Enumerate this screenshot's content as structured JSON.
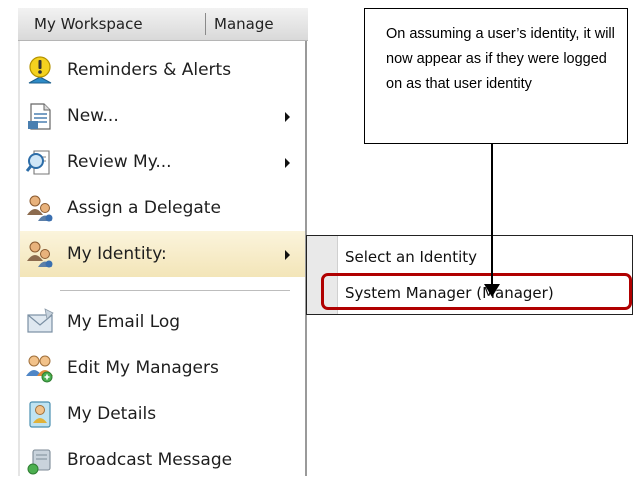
{
  "menubar": {
    "items": [
      "My Workspace",
      "Manage"
    ]
  },
  "menu": {
    "items": [
      {
        "label": "Reminders & Alerts",
        "icon": "alert-icon",
        "has_submenu": false
      },
      {
        "label": "New...",
        "icon": "new-document-icon",
        "has_submenu": true
      },
      {
        "label": "Review My...",
        "icon": "review-icon",
        "has_submenu": true
      },
      {
        "label": "Assign a Delegate",
        "icon": "delegate-icon",
        "has_submenu": false
      },
      {
        "label": "My Identity:",
        "icon": "identity-icon",
        "has_submenu": true,
        "highlighted": true
      },
      {
        "label": "My Email Log",
        "icon": "email-icon",
        "has_submenu": false
      },
      {
        "label": "Edit My Managers",
        "icon": "managers-icon",
        "has_submenu": false
      },
      {
        "label": "My Details",
        "icon": "details-icon",
        "has_submenu": false
      },
      {
        "label": "Broadcast Message",
        "icon": "broadcast-icon",
        "has_submenu": false
      }
    ]
  },
  "submenu": {
    "items": [
      "Select an Identity",
      "System Manager (Manager)"
    ]
  },
  "callout": {
    "text": "On assuming a user’s identity, it will now appear as if they were logged on as that user identity"
  },
  "colors": {
    "highlight_border": "#b00000",
    "hover_background": "#f3e5b8",
    "menubar_background": "#e3e3e3"
  }
}
